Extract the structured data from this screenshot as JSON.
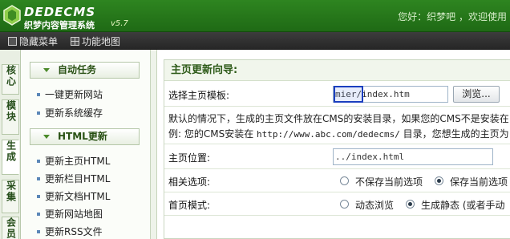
{
  "header": {
    "logo_text": "DEDECMS",
    "logo_sub": "织梦内容管理系统",
    "logo_ver": "v5.7",
    "welcome": "您好：织梦吧 ，欢迎使用"
  },
  "toolbar": {
    "hide_menu": "隐藏菜单",
    "site_map": "功能地图"
  },
  "vtabs": [
    "核心",
    "模块",
    "生成",
    "采集",
    "会员"
  ],
  "sidemenu": {
    "section1": {
      "title": "自动任务",
      "items": [
        "一键更新网站",
        "更新系统缓存"
      ]
    },
    "section2": {
      "title": "HTML更新",
      "items": [
        "更新主页HTML",
        "更新栏目HTML",
        "更新文档HTML",
        "更新网站地图",
        "更新RSS文件"
      ]
    }
  },
  "main": {
    "title": "主页更新向导:",
    "template_label": "选择主页模板:",
    "template_value": "mier/index.htm",
    "browse_button": "浏览...",
    "desc_line1": "默认的情况下，生成的主页文件放在CMS的安装目录，如果您的CMS不是安装在",
    "desc_line2_pre": "例: 您的CMS安装在 ",
    "desc_line2_url": "http://www.abc.com/dedecms/",
    "desc_line2_post": " 目录，您想生成的主页为",
    "position_label": "主页位置:",
    "position_value": "../index.html",
    "options_label": "相关选项:",
    "opt_no_save": "不保存当前选项",
    "opt_save": "保存当前选项",
    "mode_label": "首页模式:",
    "mode_dynamic": "动态浏览",
    "mode_static": "生成静态 (或者手动"
  }
}
